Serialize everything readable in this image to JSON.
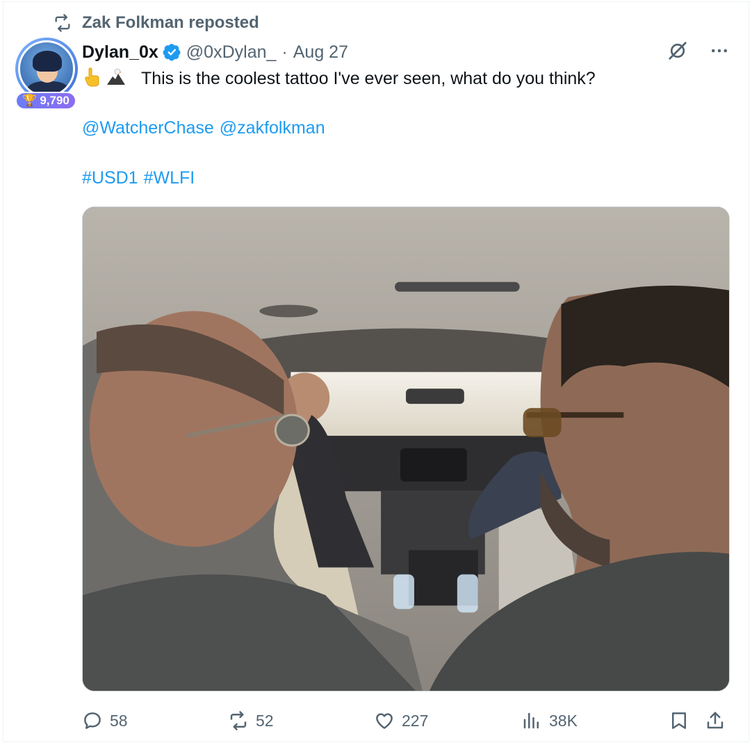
{
  "repost": {
    "label": "Zak Folkman reposted"
  },
  "author": {
    "display_name": "Dylan_0x",
    "handle": "@0xDylan_",
    "separator": "·",
    "date": "Aug 27",
    "badge_count": "9,790"
  },
  "post": {
    "text": "This is the coolest tattoo I've ever seen, what do you think?",
    "mentions": [
      "@WatcherChase",
      "@zakfolkman"
    ],
    "hashtags": [
      "#USD1",
      "#WLFI"
    ]
  },
  "metrics": {
    "replies": "58",
    "reposts": "52",
    "likes": "227",
    "views": "38K"
  },
  "colors": {
    "link": "#1d9bf0",
    "muted": "#536471",
    "verified": "#1d9bf0"
  },
  "icons": [
    "repost-icon",
    "verified-icon",
    "grok-icon",
    "more-icon",
    "reply-icon",
    "like-icon",
    "views-icon",
    "bookmark-icon",
    "share-icon"
  ]
}
